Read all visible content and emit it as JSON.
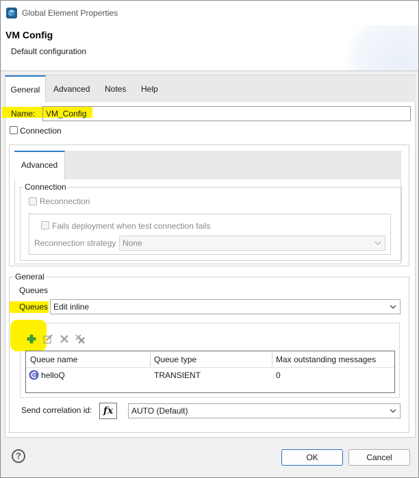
{
  "window": {
    "title": "Global Element Properties"
  },
  "header": {
    "title": "VM Config",
    "subtitle": "Default configuration"
  },
  "tabs": [
    {
      "label": "General"
    },
    {
      "label": "Advanced"
    },
    {
      "label": "Notes"
    },
    {
      "label": "Help"
    }
  ],
  "general": {
    "name_label": "Name:",
    "name_value": "VM_Config",
    "connection_checkbox_label": "Connection"
  },
  "advanced_subtab": {
    "label": "Advanced"
  },
  "connection_group": {
    "legend": "Connection",
    "reconnection_label": "Reconnection",
    "fails_deployment_label": "Fails deployment when test connection fails",
    "strategy_label": "Reconnection strategy",
    "strategy_value": "None"
  },
  "general_group": {
    "legend": "General",
    "queues_heading": "Queues",
    "queues_label": "Queues",
    "queues_value": "Edit inline",
    "table": {
      "columns": [
        "Queue name",
        "Queue type",
        "Max outstanding messages"
      ],
      "rows": [
        {
          "name": "helloQ",
          "type": "TRANSIENT",
          "max": "0"
        }
      ]
    },
    "correlation_label": "Send correlation id:",
    "correlation_value": "AUTO (Default)"
  },
  "buttons": {
    "ok": "OK",
    "cancel": "Cancel"
  },
  "colors": {
    "accent": "#2d7dc8",
    "highlight": "#fff200",
    "add_icon": "#3aa83a"
  },
  "icons": {
    "title": "app-cube-icon",
    "add": "plus-icon",
    "edit": "edit-icon",
    "delete": "delete-icon",
    "delete_all": "delete-all-icon",
    "queue_row": "queue-icon",
    "help": "help-icon",
    "expression": "fx-icon"
  }
}
